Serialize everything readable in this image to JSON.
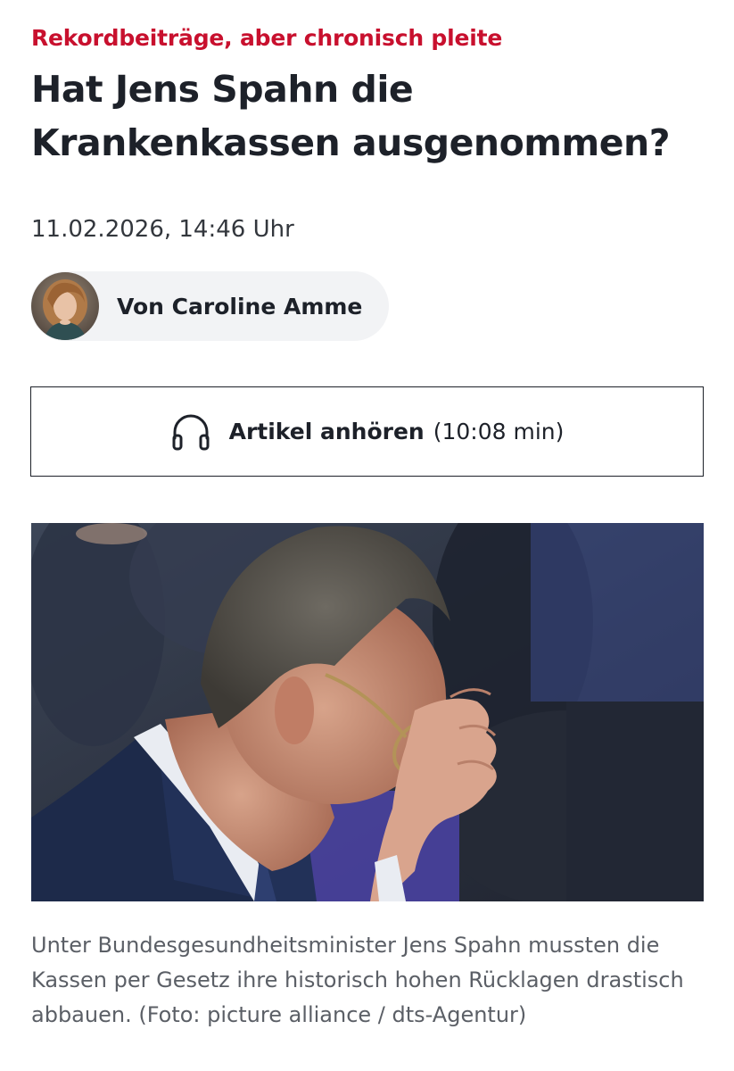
{
  "article": {
    "kicker": "Rekordbeiträge, aber chronisch pleite",
    "headline": "Hat Jens Spahn die Krankenkassen ausgenommen?",
    "date": "11.02.2026, 14:46 Uhr",
    "author": {
      "byline": "Von Caroline Amme"
    },
    "listen": {
      "label": "Artikel anhören",
      "duration": "(10:08 min)",
      "icon": "headphones-icon"
    },
    "image": {
      "caption": "Unter Bundesgesundheitsminister Jens Spahn mussten die Kassen per Gesetz ihre historisch hohen Rücklagen drastisch abbauen. (Foto: picture alliance / dts-Agentur)"
    }
  },
  "colors": {
    "kicker": "#c8102e",
    "text": "#1d2129",
    "caption": "#5b5f66",
    "pill_background": "#f2f3f5"
  }
}
